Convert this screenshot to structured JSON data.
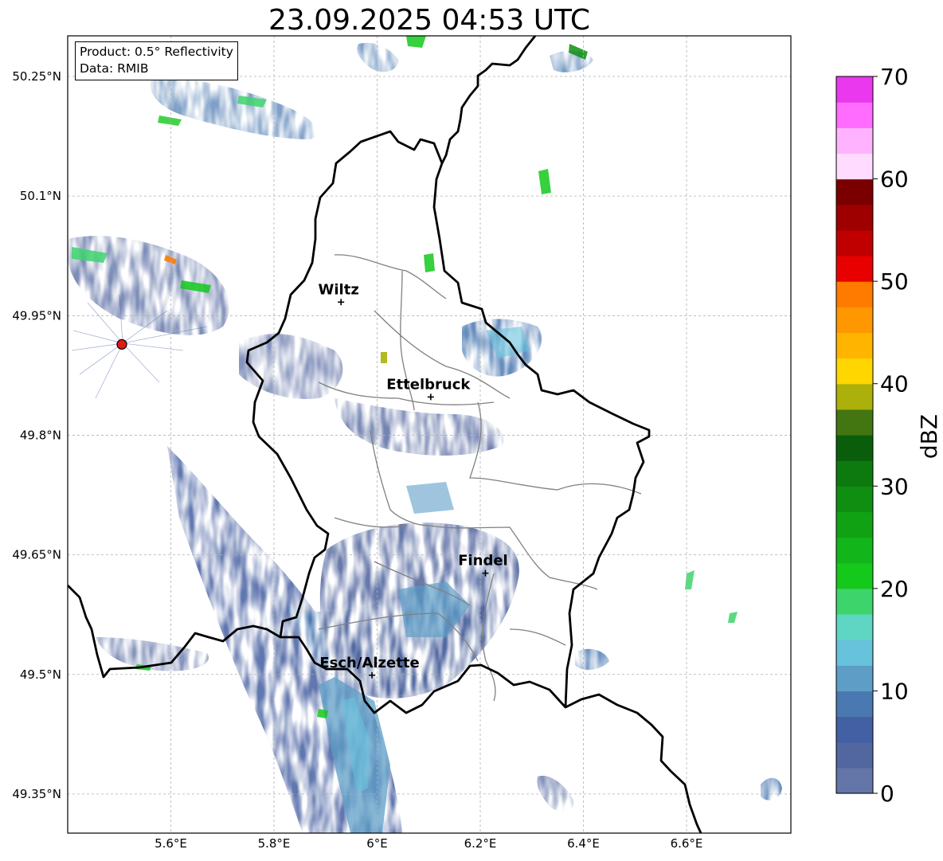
{
  "title": "23.09.2025 04:53 UTC",
  "info": {
    "product": "Product: 0.5° Reflectivity",
    "data": "Data: RMIB"
  },
  "map": {
    "lon_range": [
      5.4,
      6.8
    ],
    "lat_range": [
      49.3,
      50.3
    ],
    "x_ticks": [
      {
        "value": 5.6,
        "label": "5.6°E"
      },
      {
        "value": 5.8,
        "label": "5.8°E"
      },
      {
        "value": 6.0,
        "label": "6°E"
      },
      {
        "value": 6.2,
        "label": "6.2°E"
      },
      {
        "value": 6.4,
        "label": "6.4°E"
      },
      {
        "value": 6.6,
        "label": "6.6°E"
      }
    ],
    "y_ticks": [
      {
        "value": 50.25,
        "label": "50.25°N"
      },
      {
        "value": 50.1,
        "label": "50.1°N"
      },
      {
        "value": 49.95,
        "label": "49.95°N"
      },
      {
        "value": 49.8,
        "label": "49.8°N"
      },
      {
        "value": 49.65,
        "label": "49.65°N"
      },
      {
        "value": 49.5,
        "label": "49.5°N"
      },
      {
        "value": 49.35,
        "label": "49.35°N"
      }
    ],
    "radar_site": {
      "lon": 5.505,
      "lat": 49.914
    },
    "cities": [
      {
        "name": "Wiltz",
        "lon": 5.93,
        "lat": 49.967
      },
      {
        "name": "Ettelbruck",
        "lon": 6.104,
        "lat": 49.848
      },
      {
        "name": "Findel",
        "lon": 6.21,
        "lat": 49.627
      },
      {
        "name": "Esch/Alzette",
        "lon": 5.99,
        "lat": 49.499
      }
    ]
  },
  "colorbar": {
    "label": "dBZ",
    "min": 0,
    "max": 70,
    "step": 2.5,
    "tick_labels": [
      "0",
      "10",
      "20",
      "30",
      "40",
      "50",
      "60",
      "70"
    ],
    "colors": [
      "#6475a8",
      "#52679f",
      "#4260a3",
      "#4a79b1",
      "#5e9ec6",
      "#67c2dc",
      "#5fd5c4",
      "#3ed46c",
      "#14c81c",
      "#12b51a",
      "#11a213",
      "#0f8e12",
      "#0c7a0f",
      "#0a5e0b",
      "#437611",
      "#acb00a",
      "#ffd600",
      "#ffb400",
      "#ff9700",
      "#ff7b00",
      "#e80000",
      "#c00000",
      "#9e0000",
      "#7a0000",
      "#ffdcff",
      "#ffb3ff",
      "#ff6cff",
      "#ea38ee"
    ]
  }
}
